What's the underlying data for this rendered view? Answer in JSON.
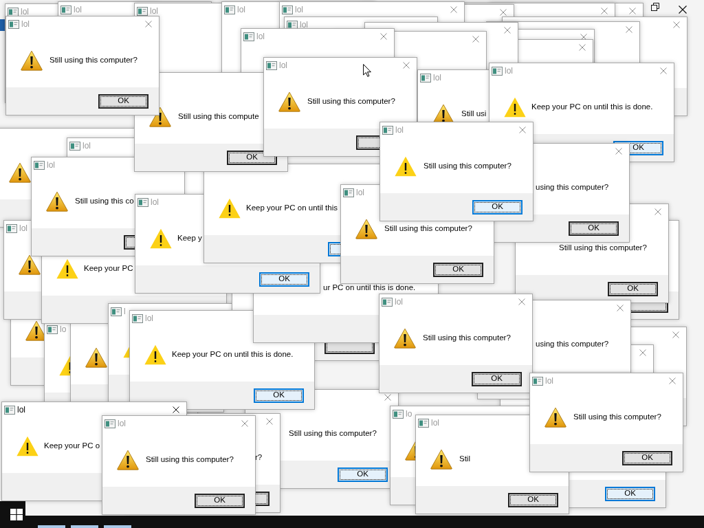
{
  "windows": [
    {
      "active": false,
      "title": "lol"
    },
    {
      "active": false,
      "title": "lol"
    },
    {
      "active": false,
      "title": "lol"
    },
    {
      "active": false,
      "title": "lol"
    },
    {
      "active": false,
      "title": "lol",
      "close_button": true
    },
    {
      "close_button": true
    },
    {
      "close_button": true
    },
    {
      "close_button": true
    },
    {
      "active": false,
      "title": "lol",
      "close_button": true,
      "warning_icon": {
        "kind": "shaded"
      },
      "message": "Still using this computer?",
      "ok_button": {
        "label": "OK",
        "focused": false
      }
    },
    {
      "active": false,
      "title": "lol"
    },
    {
      "close_button": true
    },
    {
      "close_button": true
    },
    {
      "close_button": true
    },
    {
      "active": false,
      "title": "lol",
      "close_button": true
    },
    {
      "close_button": true
    },
    {
      "close_button": true
    },
    {
      "close_button": true
    },
    {
      "active": false,
      "title": "lol"
    },
    {
      "active": false,
      "title": "lol",
      "warning_icon": {
        "kind": "shaded"
      }
    },
    {
      "active": false,
      "title": "lol",
      "warning_icon": {
        "kind": "shaded"
      },
      "message": "Still using this co",
      "ok_button": {
        "focused": false
      }
    },
    {
      "warning_icon": {
        "kind": "shaded"
      },
      "message": "Still using this compute",
      "ok_button": {
        "label": "OK",
        "focused": false
      }
    },
    {
      "active": false,
      "title": "lol",
      "close_button": true,
      "warning_icon": {
        "kind": "shaded"
      },
      "message": "Still using this computer?",
      "ok_button": {
        "focused": false
      }
    },
    {
      "active": false,
      "title": "lol",
      "warning_icon": {
        "kind": "shaded"
      },
      "message": "Still usi"
    },
    {
      "active": false,
      "title": "lol",
      "close_button": true,
      "warning_icon": {
        "kind": "flat"
      },
      "message": "Keep your PC on until this is done.",
      "ok_button": {
        "label": "OK",
        "focused": true
      }
    },
    {
      "warning_icon": {
        "kind": "shaded"
      }
    },
    {
      "warning_icon": {
        "kind": "flat"
      },
      "message": "Keep your PC"
    },
    {
      "active": false,
      "title": "lol",
      "warning_icon": {
        "kind": "flat"
      },
      "message": "Keep y",
      "ok_button": {
        "label": "OK",
        "focused": true
      }
    },
    {
      "warning_icon": {
        "kind": "flat"
      },
      "message": "Keep your PC on until this",
      "ok_button": {
        "focused": true
      }
    },
    {
      "active": false,
      "title": "lol",
      "close_button": true,
      "warning_icon": {
        "kind": "flat"
      },
      "message": "Still using this computer?",
      "ok_button": {
        "label": "OK",
        "focused": true
      }
    },
    {
      "active": false,
      "title": "lol",
      "warning_icon": {
        "kind": "shaded"
      },
      "message": "Still using this computer?",
      "ok_button": {
        "label": "OK",
        "focused": false
      }
    },
    {
      "close_button": true,
      "message": "using this computer?",
      "ok_button": {
        "label": "OK",
        "focused": false
      }
    },
    {
      "message": "ur PC on until this is done."
    },
    {
      "close_button": true,
      "message": "Still using this computer?",
      "ok_button": {
        "label": "OK",
        "focused": false
      }
    },
    {
      "active": false,
      "title": "l",
      "warning_icon": {
        "kind": "flat"
      }
    },
    {
      "warning_icon": {
        "kind": "shaded"
      }
    },
    {
      "active": false,
      "title": "lo",
      "warning_icon": {
        "kind": "flat"
      }
    },
    {
      "warning_icon": {
        "kind": "shaded"
      }
    },
    {
      "active": false,
      "title": "lol",
      "warning_icon": {
        "kind": "flat"
      },
      "message": "Keep your PC on until this is done.",
      "ok_button": {
        "label": "OK",
        "focused": true
      }
    },
    {
      "ok_button": {
        "focused": false
      }
    },
    {
      "active": false,
      "title": "lol",
      "close_button": true,
      "warning_icon": {
        "kind": "shaded"
      },
      "message": "Still using this computer?",
      "ok_button": {
        "label": "OK",
        "focused": false
      }
    },
    {
      "ok_button": {
        "focused": false
      }
    },
    {
      "close_button": true
    },
    {
      "close_button": true,
      "message": "using this computer?"
    },
    {
      "close_button": true
    },
    {
      "active": true,
      "title": "lol",
      "close_button": true,
      "warning_icon": {
        "kind": "flat"
      },
      "message": "Keep your PC o"
    },
    {
      "active": false,
      "title": "lol",
      "close_button": true,
      "warning_icon": {
        "kind": "shaded"
      },
      "message": "Still using this computer?",
      "ok_button": {
        "label": "OK",
        "focused": false
      }
    },
    {
      "close_button": true,
      "message": "r?",
      "ok_button": {
        "focused": false
      }
    },
    {
      "close_button": true,
      "message": "Still using this computer?",
      "ok_button": {
        "label": "OK",
        "focused": true
      }
    },
    {
      "active": false,
      "title": "lo",
      "warning_icon": {
        "kind": "shaded"
      }
    },
    {
      "active": false,
      "title": "lol",
      "close_button": true,
      "warning_icon": {
        "kind": "shaded"
      },
      "message": "Still using this computer?",
      "ok_button": {
        "label": "OK",
        "focused": false
      }
    },
    {
      "active": false,
      "title": "lol",
      "warning_icon": {
        "kind": "shaded"
      },
      "message": "Stil",
      "ok_button": {
        "label": "OK",
        "focused": false
      }
    },
    {
      "ok_button": {
        "label": "OK",
        "focused": true
      }
    }
  ]
}
